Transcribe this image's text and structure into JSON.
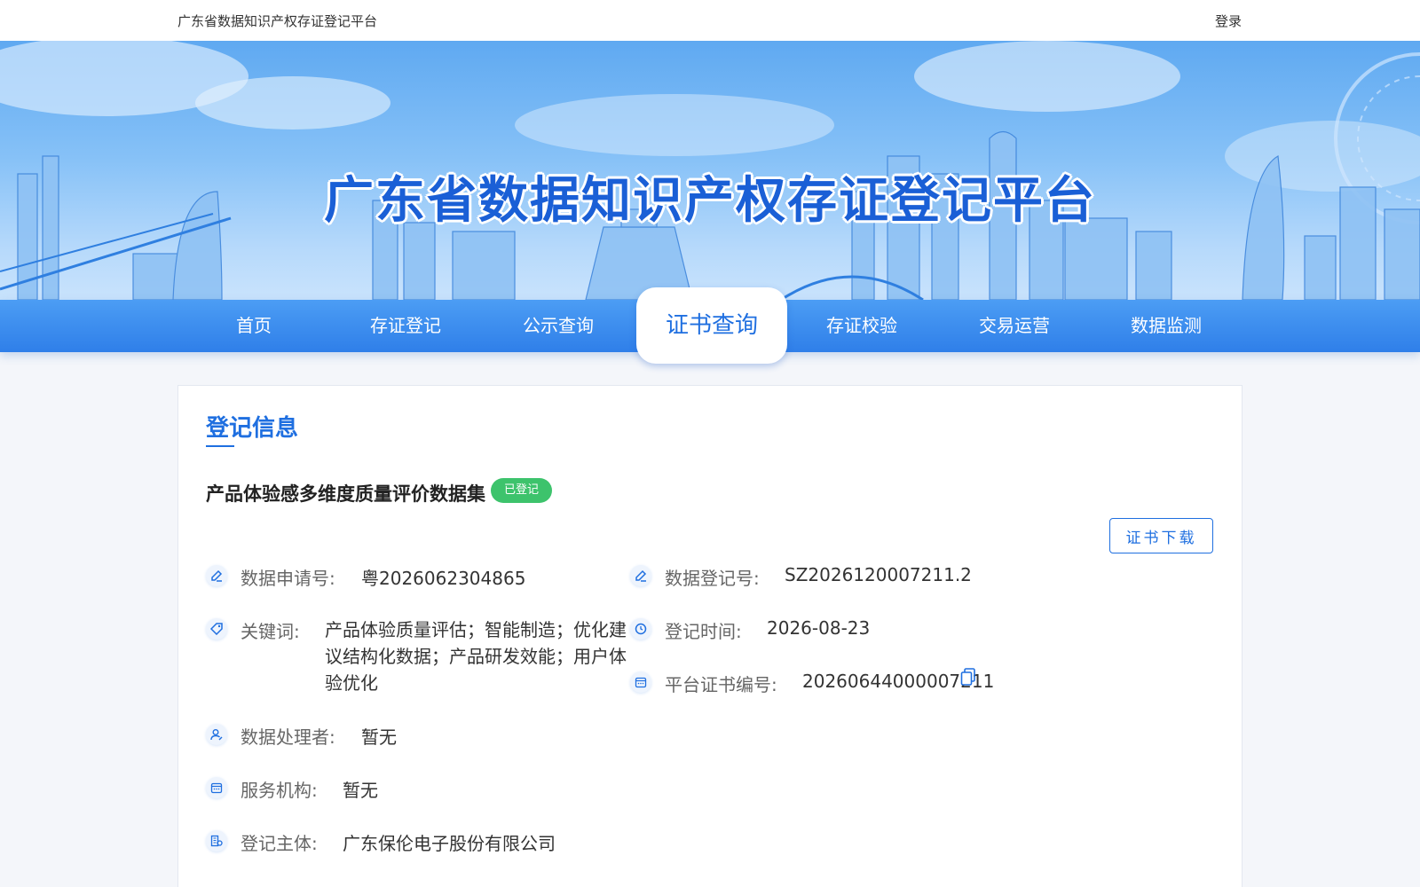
{
  "header": {
    "site_name": "广东省数据知识产权存证登记平台",
    "login_label": "登录"
  },
  "banner": {
    "title": "广东省数据知识产权存证登记平台"
  },
  "nav": {
    "items": [
      {
        "label": "首页",
        "active": false
      },
      {
        "label": "存证登记",
        "active": false
      },
      {
        "label": "公示查询",
        "active": false
      },
      {
        "label": "证书查询",
        "active": true
      },
      {
        "label": "存证校验",
        "active": false
      },
      {
        "label": "交易运营",
        "active": false
      },
      {
        "label": "数据监测",
        "active": false
      }
    ]
  },
  "panel": {
    "title": "登记信息",
    "dataset_name": "产品体验感多维度质量评价数据集",
    "status": "已登记",
    "download_label": "证书下载",
    "fields": {
      "application_no": {
        "label": "数据申请号:",
        "value": "粤2026062304865",
        "icon": "edit-icon"
      },
      "registration_no": {
        "label": "数据登记号:",
        "value": "SZ2026120007211.2",
        "icon": "edit-icon"
      },
      "keywords": {
        "label": "关键词:",
        "value": "产品体验质量评估；智能制造；优化建议结构化数据；产品研发效能；用户体验优化",
        "icon": "tag-icon"
      },
      "registration_time": {
        "label": "登记时间:",
        "value": "2026-08-23",
        "icon": "clock-icon"
      },
      "certificate_no": {
        "label": "平台证书编号:",
        "value": "20260644000007211",
        "icon": "calendar-icon"
      },
      "processor": {
        "label": "数据处理者:",
        "value": "暂无",
        "icon": "user-icon"
      },
      "service_org": {
        "label": "服务机构:",
        "value": "暂无",
        "icon": "calendar-icon"
      },
      "subject": {
        "label": "登记主体:",
        "value": "广东保伦电子股份有限公司",
        "icon": "building-icon"
      }
    }
  },
  "colors": {
    "primary": "#1f6fe0",
    "nav_bg": "#3a8cf0",
    "badge_green": "#3dc36c"
  }
}
